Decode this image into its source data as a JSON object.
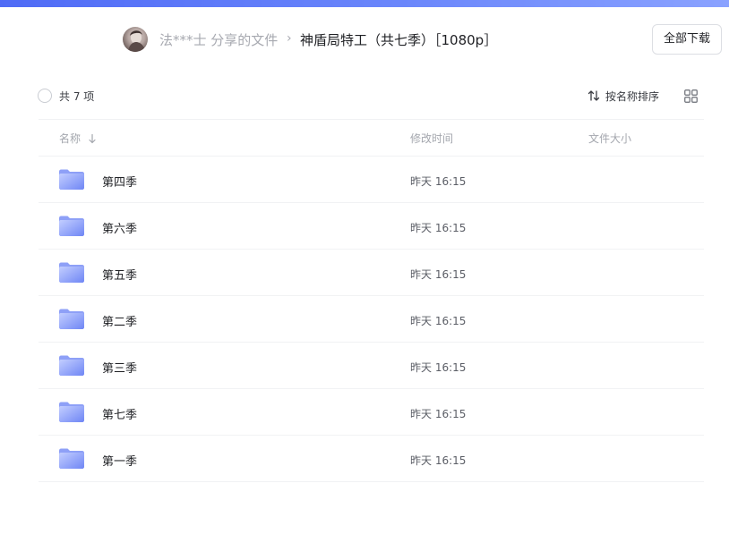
{
  "header": {
    "owner_label": "法***士 分享的文件",
    "separator": "›",
    "title": "神盾局特工（共七季）［1080p］",
    "download_all_label": "全部下载"
  },
  "toolbar": {
    "count_label": "共 7 项",
    "sort_label": "按名称排序",
    "sort_icon": "sort-arrows-icon",
    "view_icon": "grid-view-icon"
  },
  "table": {
    "columns": {
      "name": "名称",
      "modified": "修改时间",
      "size": "文件大小"
    },
    "rows": [
      {
        "name": "第四季",
        "modified": "昨天 16:15",
        "size": ""
      },
      {
        "name": "第六季",
        "modified": "昨天 16:15",
        "size": ""
      },
      {
        "name": "第五季",
        "modified": "昨天 16:15",
        "size": ""
      },
      {
        "name": "第二季",
        "modified": "昨天 16:15",
        "size": ""
      },
      {
        "name": "第三季",
        "modified": "昨天 16:15",
        "size": ""
      },
      {
        "name": "第七季",
        "modified": "昨天 16:15",
        "size": ""
      },
      {
        "name": "第一季",
        "modified": "昨天 16:15",
        "size": ""
      }
    ]
  },
  "colors": {
    "accent": "#4f6bf6",
    "folder_light": "#b9c6ff",
    "folder_dark": "#6f86f5"
  }
}
